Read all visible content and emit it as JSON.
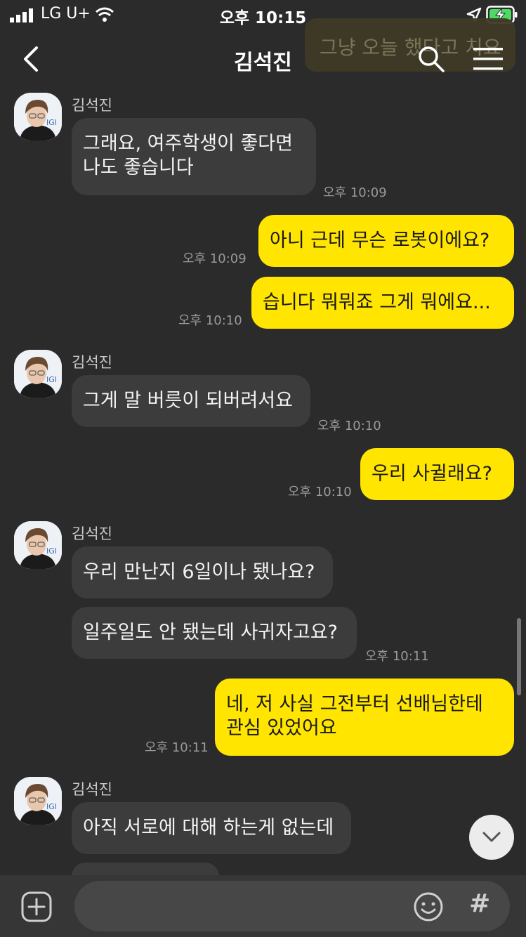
{
  "status_bar": {
    "carrier": "LG U+",
    "time": "오후 10:15"
  },
  "header": {
    "title": "김석진",
    "overlay_text": "그냥 오늘 했다고 치요"
  },
  "messages": [
    {
      "sender": "김석진",
      "text": "그래요, 여주학생이 좋다면\n나도 좋습니다",
      "time": "오후 10:09"
    },
    {
      "text": "아니 근데 무슨 로봇이에요?",
      "time": "오후 10:09"
    },
    {
      "text": "습니다 뭐뭐죠 그게 뭐에요...",
      "time": "오후 10:10"
    },
    {
      "sender": "김석진",
      "text": "그게 말 버릇이 되버려서요",
      "time": "오후 10:10"
    },
    {
      "text": "우리 사귈래요?",
      "time": "오후 10:10"
    },
    {
      "sender": "김석진",
      "text": "우리 만난지 6일이나 됐나요?"
    },
    {
      "text": "일주일도 안 됐는데 사귀자고요?",
      "time": "오후 10:11"
    },
    {
      "text": "네, 저 사실 그전부터 선배님한테\n관심 있었어요",
      "time": "오후 10:11"
    },
    {
      "sender": "김석진",
      "text": "아직 서로에 대해 하는게 없는데"
    }
  ],
  "input": {
    "value": "",
    "placeholder": ""
  },
  "icons": {
    "back": "chevron-left-icon",
    "search": "search-icon",
    "menu": "menu-icon",
    "scroll_down": "chevron-down-icon",
    "add": "plus-square-icon",
    "emoji": "emoji-icon",
    "hash": "#"
  },
  "colors": {
    "background": "#2b2b2b",
    "incoming_bubble": "#3c3c3c",
    "outgoing_bubble": "#ffe500",
    "timestamp": "#9a9a9a"
  }
}
